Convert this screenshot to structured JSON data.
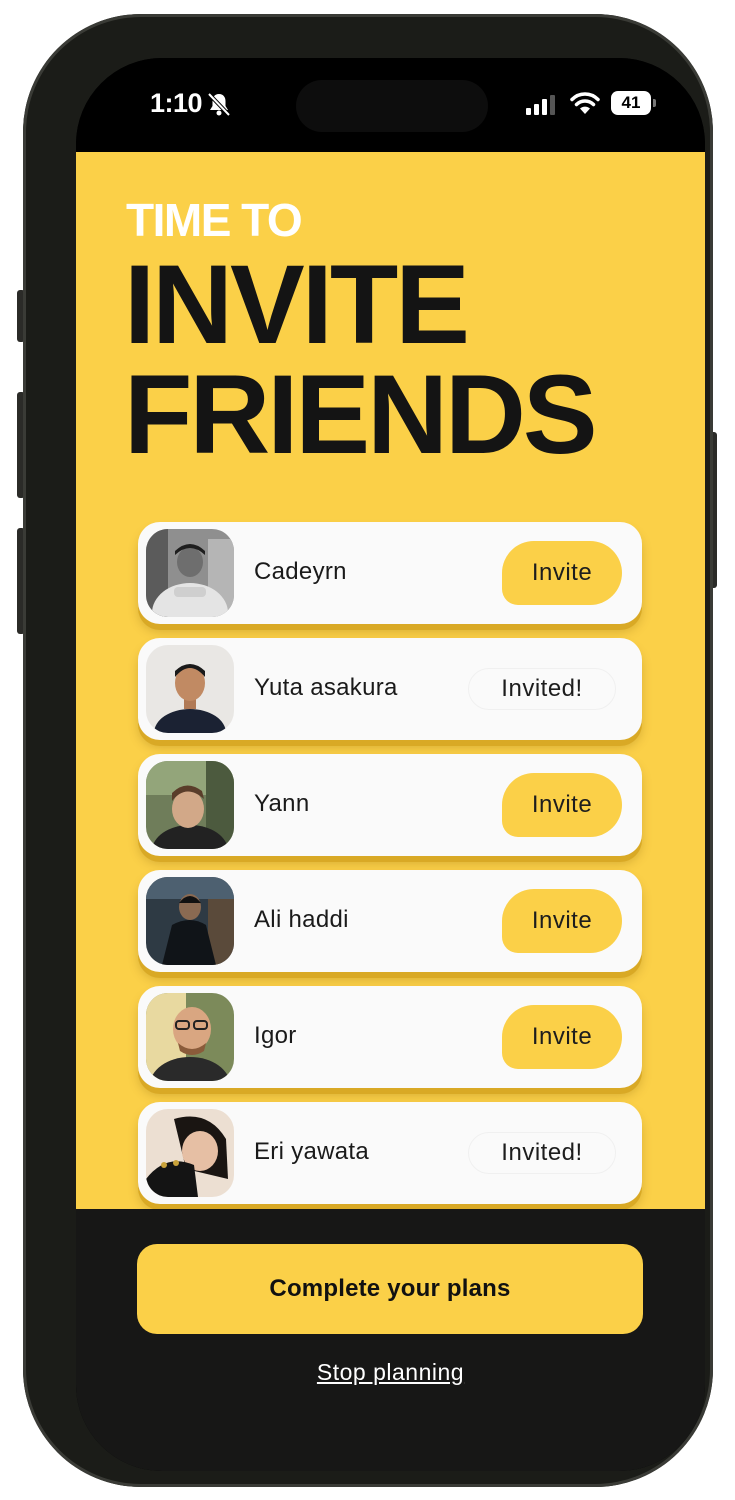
{
  "status_bar": {
    "time": "1:10",
    "battery": "41"
  },
  "header": {
    "eyebrow": "TIME TO",
    "title_line1": "INVITE",
    "title_line2": "FRIENDS"
  },
  "friends": [
    {
      "name": "Cadeyrn",
      "status": "Invite"
    },
    {
      "name": "Yuta asakura",
      "status": "Invited!"
    },
    {
      "name": "Yann",
      "status": "Invite"
    },
    {
      "name": "Ali haddi",
      "status": "Invite"
    },
    {
      "name": "Igor",
      "status": "Invite"
    },
    {
      "name": "Eri yawata",
      "status": "Invited!"
    }
  ],
  "footer": {
    "primary_button": "Complete your plans",
    "secondary_link": "Stop planning"
  },
  "colors": {
    "accent": "#fbd048",
    "dark": "#171716",
    "card": "#fafafa"
  }
}
